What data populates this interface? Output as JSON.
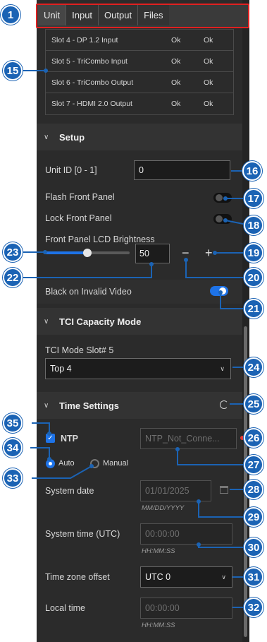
{
  "tabs": [
    "Unit",
    "Input",
    "Output",
    "Files"
  ],
  "slot_rows": [
    {
      "name": "Slot 4 - DP 1.2 Input",
      "s1": "Ok",
      "s2": "Ok"
    },
    {
      "name": "Slot 5 - TriCombo Input",
      "s1": "Ok",
      "s2": "Ok"
    },
    {
      "name": "Slot 6 - TriCombo Output",
      "s1": "Ok",
      "s2": "Ok"
    },
    {
      "name": "Slot 7 - HDMI 2.0 Output",
      "s1": "Ok",
      "s2": "Ok"
    }
  ],
  "setup": {
    "title": "Setup",
    "unit_id_label": "Unit ID [0 - 1]",
    "unit_id_value": "0",
    "flash_front_panel_label": "Flash Front Panel",
    "flash_front_panel_on": false,
    "lock_front_panel_label": "Lock Front Panel",
    "lock_front_panel_on": false,
    "lcd_brightness_label": "Front Panel LCD Brightness",
    "lcd_brightness_value": "50",
    "lcd_brightness_fraction": 0.5,
    "minus_glyph": "−",
    "plus_glyph": "+",
    "black_on_invalid_label": "Black on Invalid Video",
    "black_on_invalid_on": true
  },
  "tci": {
    "title": "TCI Capacity Mode",
    "slot_label": "TCI Mode Slot# 5",
    "slot_value": "Top 4"
  },
  "time": {
    "title": "Time Settings",
    "ntp_label": "NTP",
    "ntp_checked": true,
    "auto_label": "Auto",
    "manual_label": "Manual",
    "ntp_status_placeholder": "NTP_Not_Conne...",
    "system_date_label": "System date",
    "system_date_value": "01/01/2025",
    "system_date_hint": "MM/DD/YYYY",
    "system_time_label": "System time (UTC)",
    "system_time_value": "00:00:00",
    "system_time_hint": "HH:MM:SS",
    "tz_label": "Time zone offset",
    "tz_value": "UTC 0",
    "local_time_label": "Local time",
    "local_time_value": "00:00:00",
    "local_time_hint": "HH:MM:SS"
  },
  "callouts": [
    "1",
    "15",
    "16",
    "17",
    "18",
    "19",
    "20",
    "21",
    "22",
    "23",
    "24",
    "25",
    "26",
    "27",
    "28",
    "29",
    "30",
    "31",
    "32",
    "33",
    "34",
    "35"
  ],
  "colors": {
    "accent": "#1e73e8",
    "callout": "#1b63b4",
    "highlight": "#e02020",
    "status_error": "#e53935"
  }
}
